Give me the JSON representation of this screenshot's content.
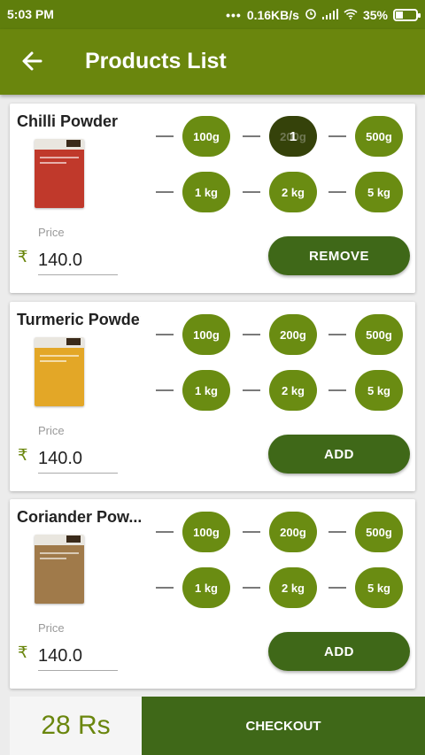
{
  "status_bar": {
    "time": "5:03 PM",
    "network_speed": "0.16KB/s",
    "battery_percent": "35%"
  },
  "app_bar": {
    "title": "Products List"
  },
  "products": [
    {
      "name": "Chilli Powder",
      "price_label": "Price",
      "currency_symbol": "₹",
      "price": "140.0",
      "sizes_row1": [
        "100g",
        "200g",
        "500g"
      ],
      "sizes_row2": [
        "1 kg",
        "2 kg",
        "5 kg"
      ],
      "selected_size": "200g",
      "selected_badge": "1",
      "action_label": "REMOVE",
      "thumb_color": "#c0392b"
    },
    {
      "name": "Turmeric Powder",
      "price_label": "Price",
      "currency_symbol": "₹",
      "price": "140.0",
      "sizes_row1": [
        "100g",
        "200g",
        "500g"
      ],
      "sizes_row2": [
        "1 kg",
        "2 kg",
        "5 kg"
      ],
      "selected_size": "",
      "selected_badge": "",
      "action_label": "ADD",
      "thumb_color": "#e3a727"
    },
    {
      "name": "Coriander Pow...",
      "price_label": "Price",
      "currency_symbol": "₹",
      "price": "140.0",
      "sizes_row1": [
        "100g",
        "200g",
        "500g"
      ],
      "sizes_row2": [
        "1 kg",
        "2 kg",
        "5 kg"
      ],
      "selected_size": "",
      "selected_badge": "",
      "action_label": "ADD",
      "thumb_color": "#a07a4a"
    }
  ],
  "footer": {
    "total": "28 Rs",
    "checkout_label": "CHECKOUT"
  },
  "colors": {
    "primary": "#6a860d",
    "button": "#3f6818",
    "pill": "#6a8c12",
    "pill_selected": "#35420a"
  }
}
